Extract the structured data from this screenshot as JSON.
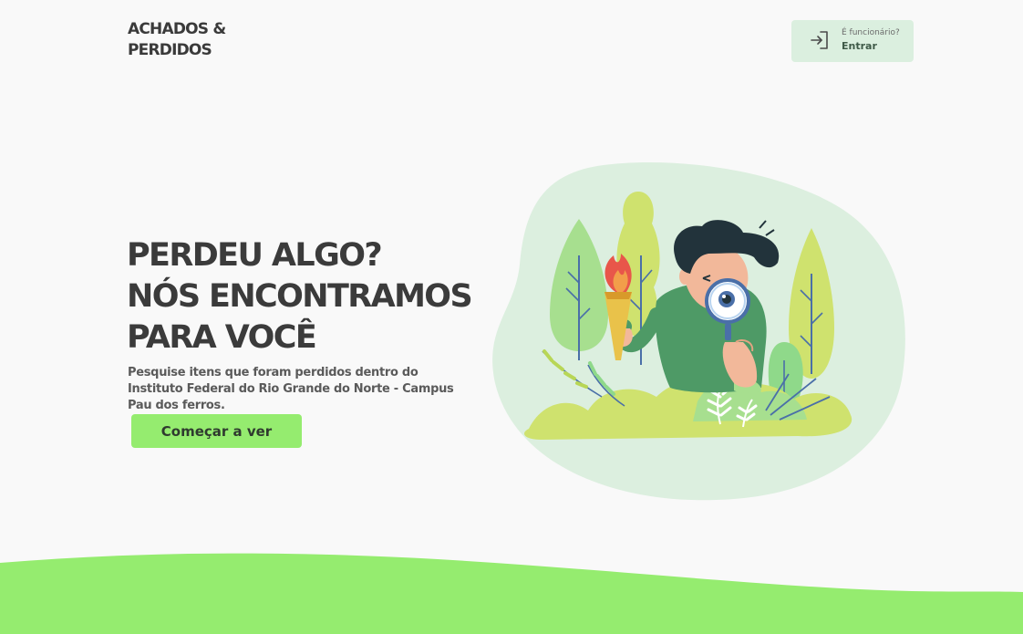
{
  "header": {
    "logo_line1": "ACHADOS &",
    "logo_line2": "PERDIDOS",
    "login": {
      "subtitle": "É funcionário?",
      "label": "Entrar",
      "icon": "login-icon"
    }
  },
  "hero": {
    "title_line1": "PERDEU ALGO?",
    "title_line2": "NÓS ENCONTRAMOS",
    "title_line3": "PARA VOCÊ",
    "description": "Pesquise itens que foram perdidos dentro do Instituto Federal do Rio Grande do Norte - Campus Pau dos ferros.",
    "cta_label": "Começar a ver"
  },
  "colors": {
    "background": "#f9f9f9",
    "accent_green": "#95ec6f",
    "light_green": "#dbefdf",
    "text_dark": "#3b3b3b"
  }
}
